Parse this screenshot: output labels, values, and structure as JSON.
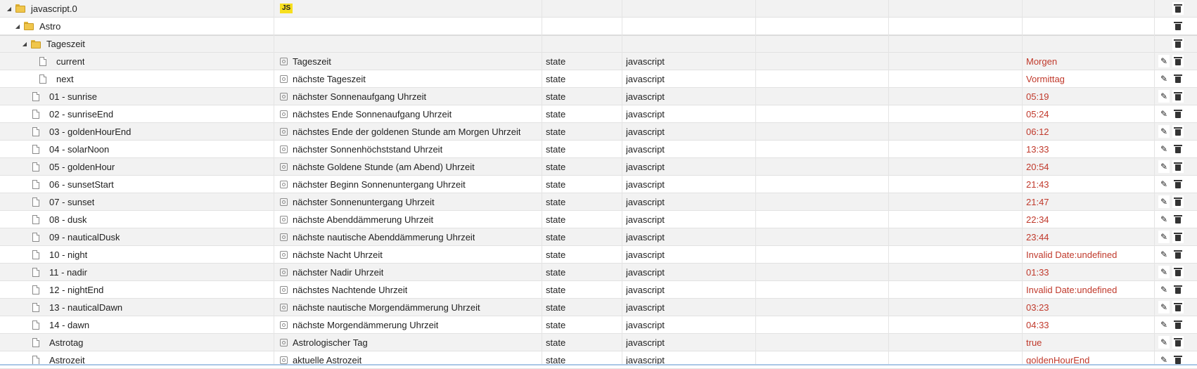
{
  "tree": {
    "root": {
      "name": "javascript.0",
      "badge": "JS"
    },
    "astro": {
      "name": "Astro"
    },
    "tageszeit": {
      "name": "Tageszeit"
    },
    "rows": [
      {
        "id": "current",
        "name": "Tageszeit",
        "role": "state",
        "room": "javascript",
        "value": "Morgen"
      },
      {
        "id": "next",
        "name": "nächste Tageszeit",
        "role": "state",
        "room": "javascript",
        "value": "Vormittag"
      },
      {
        "id": "01 - sunrise",
        "name": "nächster Sonnenaufgang Uhrzeit",
        "role": "state",
        "room": "javascript",
        "value": "05:19"
      },
      {
        "id": "02 - sunriseEnd",
        "name": "nächstes Ende Sonnenaufgang Uhrzeit",
        "role": "state",
        "room": "javascript",
        "value": "05:24"
      },
      {
        "id": "03 - goldenHourEnd",
        "name": "nächstes Ende der goldenen Stunde am Morgen Uhrzeit",
        "role": "state",
        "room": "javascript",
        "value": "06:12"
      },
      {
        "id": "04 - solarNoon",
        "name": "nächster Sonnenhöchststand Uhrzeit",
        "role": "state",
        "room": "javascript",
        "value": "13:33"
      },
      {
        "id": "05 - goldenHour",
        "name": "nächste Goldene Stunde (am Abend) Uhrzeit",
        "role": "state",
        "room": "javascript",
        "value": "20:54"
      },
      {
        "id": "06 - sunsetStart",
        "name": "nächster Beginn Sonnenuntergang Uhrzeit",
        "role": "state",
        "room": "javascript",
        "value": "21:43"
      },
      {
        "id": "07 - sunset",
        "name": "nächster Sonnenuntergang Uhrzeit",
        "role": "state",
        "room": "javascript",
        "value": "21:47"
      },
      {
        "id": "08 - dusk",
        "name": "nächste Abenddämmerung Uhrzeit",
        "role": "state",
        "room": "javascript",
        "value": "22:34"
      },
      {
        "id": "09 - nauticalDusk",
        "name": "nächste nautische Abenddämmerung Uhrzeit",
        "role": "state",
        "room": "javascript",
        "value": "23:44"
      },
      {
        "id": "10 - night",
        "name": "nächste Nacht Uhrzeit",
        "role": "state",
        "room": "javascript",
        "value": "Invalid Date:undefined"
      },
      {
        "id": "11 - nadir",
        "name": "nächster Nadir Uhrzeit",
        "role": "state",
        "room": "javascript",
        "value": "01:33"
      },
      {
        "id": "12 - nightEnd",
        "name": "nächstes Nachtende Uhrzeit",
        "role": "state",
        "room": "javascript",
        "value": "Invalid Date:undefined"
      },
      {
        "id": "13 - nauticalDawn",
        "name": "nächste nautische Morgendämmerung Uhrzeit",
        "role": "state",
        "room": "javascript",
        "value": "03:23"
      },
      {
        "id": "14 - dawn",
        "name": "nächste Morgendämmerung Uhrzeit",
        "role": "state",
        "room": "javascript",
        "value": "04:33"
      },
      {
        "id": "Astrotag",
        "name": "Astrologischer Tag",
        "role": "state",
        "room": "javascript",
        "value": "true"
      },
      {
        "id": "Astrozeit",
        "name": "aktuelle Astrozeit",
        "role": "state",
        "room": "javascript",
        "value": "goldenHourEnd"
      }
    ]
  },
  "colors": {
    "value": "#c0392b",
    "folder": "#f0c64c",
    "js_badge": "#f7df1e"
  }
}
